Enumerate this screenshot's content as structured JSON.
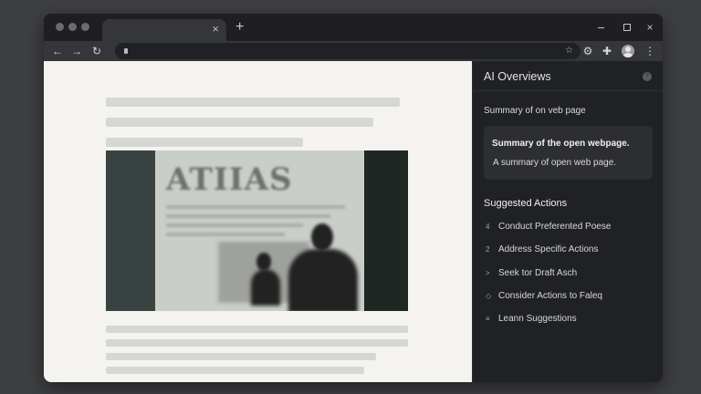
{
  "browser": {
    "tab_close": "×",
    "new_tab": "+",
    "window_close": "×",
    "toolbar": {
      "back_icon": "←",
      "forward_icon": "→",
      "reload_icon": "↻",
      "star_icon": "☆",
      "extension_icon": "⚙",
      "puzzle_icon": "✚",
      "menu_icon": "⋮"
    }
  },
  "page": {
    "image_headline": "ATIIAS"
  },
  "side_panel": {
    "title": "AI Overviews",
    "help_icon": "?",
    "summary_label": "Summary of on veb page",
    "summary_card": {
      "heading": "Summary of the open webpage.",
      "text": "A summary of open web page."
    },
    "actions_heading": "Suggested Actions",
    "actions": [
      {
        "icon": "4",
        "icon_name": "number-icon",
        "label": "Conduct Preferented Poese"
      },
      {
        "icon": "2",
        "icon_name": "number-icon",
        "label": "Address Specific Actions"
      },
      {
        "icon": ">",
        "icon_name": "chevron-right-icon",
        "label": "Seek tor Draft Asch"
      },
      {
        "icon": "◇",
        "icon_name": "diamond-icon",
        "label": "Consider Actions to Faleq"
      },
      {
        "icon": "≡",
        "icon_name": "list-icon",
        "label": "Leann Suggestions"
      }
    ]
  },
  "colors": {
    "panel_bg": "#202124",
    "card_bg": "#2d2e31",
    "page_bg": "#f4f3ef",
    "placeholder_bar": "#d6d6d4"
  }
}
